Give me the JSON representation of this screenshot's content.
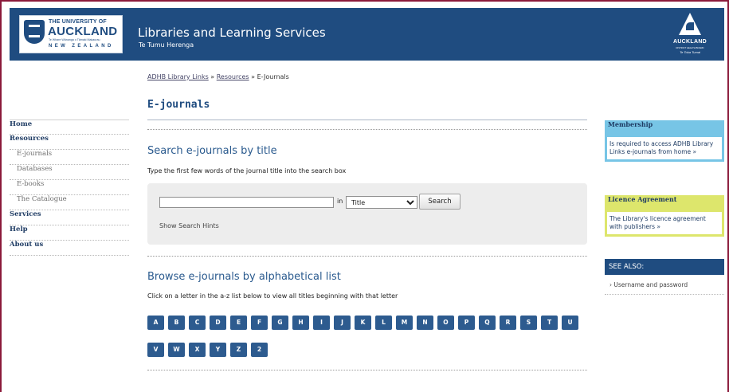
{
  "header": {
    "uni_logo": {
      "line1": "THE UNIVERSITY OF",
      "line2": "AUCKLAND",
      "line3": "Te Whare Wānanga o Tāmaki Makaurau",
      "line4": "NEW ZEALAND"
    },
    "site_title": "Libraries and Learning Services",
    "site_subtitle": "Te Tumu Herenga",
    "adhb_logo": {
      "name": "AUCKLAND",
      "sub": "DISTRICT HEALTH BOARD",
      "tag": "Te Toka Tumai"
    }
  },
  "left_nav": [
    {
      "label": "Home",
      "level": "top"
    },
    {
      "label": "Resources",
      "level": "top"
    },
    {
      "label": "E-journals",
      "level": "sub"
    },
    {
      "label": "Databases",
      "level": "sub"
    },
    {
      "label": "E-books",
      "level": "sub"
    },
    {
      "label": "The Catalogue",
      "level": "sub"
    },
    {
      "label": "Services",
      "level": "top"
    },
    {
      "label": "Help",
      "level": "top"
    },
    {
      "label": "About us",
      "level": "top"
    }
  ],
  "breadcrumb": {
    "link1": "ADHB Library Links",
    "sep1": " » ",
    "link2": "Resources",
    "sep2": " » ",
    "current": "E-Journals"
  },
  "page_title": "E-journals",
  "search_section": {
    "heading": "Search e-journals by title",
    "instructions": "Type the first few words of the journal title into the search box",
    "input_value": "",
    "in_label": "in",
    "field_selected": "Title",
    "search_button": "Search",
    "hints_link": "Show Search Hints"
  },
  "browse_section": {
    "heading": "Browse e-journals by alphabetical list",
    "instructions": "Click on a letter in the a-z list below to view all titles beginning with that letter",
    "row1": [
      "A",
      "B",
      "C",
      "D",
      "E",
      "F",
      "G",
      "H",
      "I",
      "J",
      "K",
      "L",
      "M",
      "N",
      "O",
      "P",
      "Q",
      "R",
      "S",
      "T",
      "U"
    ],
    "row2": [
      "V",
      "W",
      "X",
      "Y",
      "Z",
      "2"
    ]
  },
  "sidebar": {
    "membership": {
      "title": "Membership",
      "body": "Is required to access ADHB Library Links e-journals from home »"
    },
    "licence": {
      "title": "Licence Agreement",
      "body": "The Library's licence agreement with publishers »"
    },
    "see_also": {
      "title": "SEE ALSO:",
      "item": "›  Username and password"
    }
  },
  "colors": {
    "header_bg": "#1f4c80",
    "frame": "#8b1a3a",
    "heading_blue": "#2a5a8e",
    "az_button": "#2d5b8f",
    "membership_box": "#77c5e6",
    "licence_box": "#dde66c"
  }
}
